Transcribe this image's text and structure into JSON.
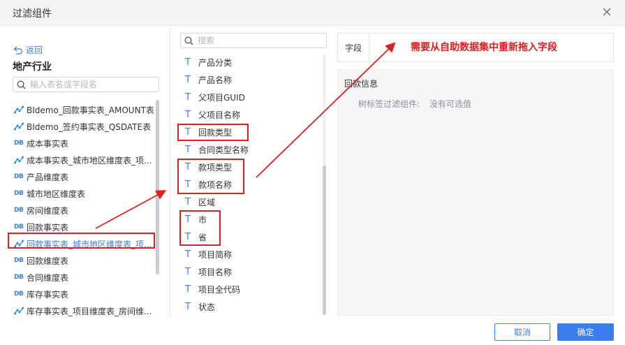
{
  "dialog": {
    "title": "过滤组件"
  },
  "left": {
    "back_label": "返回",
    "package_title": "地产行业",
    "search_placeholder": "输入表名或字段名",
    "tables": [
      {
        "label": "BIdemo_回款事实表_AMOUNT表",
        "icon": "etl-icon"
      },
      {
        "label": "BIdemo_签约事实表_QSDATE表",
        "icon": "etl-icon"
      },
      {
        "label": "成本事实表",
        "icon": "db-icon"
      },
      {
        "label": "成本事实表_城市地区维度表_项...",
        "icon": "etl-icon"
      },
      {
        "label": "产品维度表",
        "icon": "db-icon"
      },
      {
        "label": "城市地区维度表",
        "icon": "db-icon"
      },
      {
        "label": "房间维度表",
        "icon": "db-icon"
      },
      {
        "label": "回款事实表",
        "icon": "db-icon"
      },
      {
        "label": "回款事实表_城市地区维度表_项...",
        "icon": "etl-icon",
        "selected": true
      },
      {
        "label": "回款维度表",
        "icon": "db-icon"
      },
      {
        "label": "合同维度表",
        "icon": "db-icon"
      },
      {
        "label": "库存事实表",
        "icon": "db-icon"
      },
      {
        "label": "库存事实表_项目维度表_房间维...",
        "icon": "etl-icon"
      }
    ],
    "db_icon_text": "DB"
  },
  "middle": {
    "search_placeholder": "搜索",
    "type_glyph": "T",
    "fields": [
      "产品分类",
      "产品名称",
      "父项目GUID",
      "父项目名称",
      "回款类型",
      "合同类型名称",
      "款项类型",
      "款项名称",
      "区域",
      "市",
      "省",
      "项目简称",
      "项目名称",
      "项目全代码",
      "状态"
    ]
  },
  "right": {
    "field_label": "字段",
    "info_title": "回款信息",
    "info_row_label": "树标签过滤组件:",
    "info_row_value": "没有可选值"
  },
  "annotation": "需要从自助数据集中重新拖入字段",
  "footer": {
    "cancel_label": "取消",
    "ok_label": "确定"
  },
  "colors": {
    "accent": "#3a7ef0",
    "annotation_red": "#e02020",
    "header_bg": "#f3f4f6"
  }
}
